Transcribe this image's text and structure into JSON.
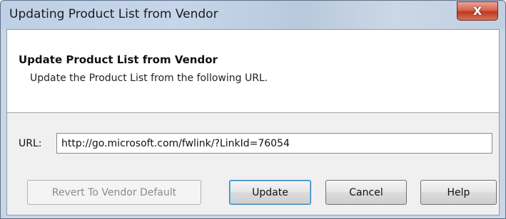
{
  "window": {
    "title": "Updating Product List from Vendor"
  },
  "titlebar_controls": {
    "close_glyph": "X",
    "close_icon": "close-icon"
  },
  "header": {
    "title": "Update Product List from Vendor",
    "description": "Update the Product List from the following URL."
  },
  "url_field": {
    "label": "URL:",
    "value": "http://go.microsoft.com/fwlink/?LinkId=76054"
  },
  "buttons": {
    "revert_label": "Revert To Vendor Default",
    "revert_enabled": false,
    "update_label": "Update",
    "update_is_default": true,
    "cancel_label": "Cancel",
    "help_label": "Help"
  },
  "colors": {
    "titlebar": "#c6d5e9",
    "close_button": "#c0391f",
    "dialog_background": "#f0f0f0",
    "header_background": "#ffffff",
    "default_button_border": "#3c7fb1"
  }
}
